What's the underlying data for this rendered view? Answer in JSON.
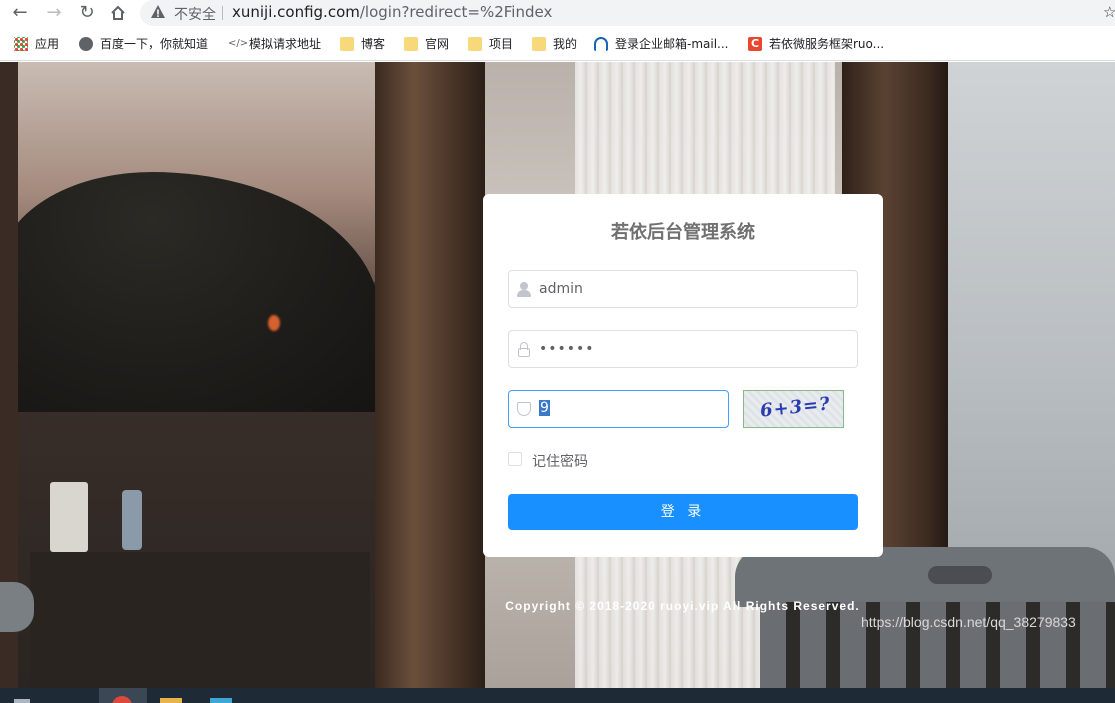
{
  "browser": {
    "security_label": "不安全",
    "url_host": "xuniji.config.com",
    "url_path": "/login?redirect=%2Findex"
  },
  "bookmarks": [
    {
      "label": "应用",
      "icon": "apps-grid-icon"
    },
    {
      "label": "百度一下，你就知道",
      "icon": "globe-icon"
    },
    {
      "label": "模拟请求地址",
      "icon": "code-icon"
    },
    {
      "label": "博客",
      "icon": "folder-icon"
    },
    {
      "label": "官网",
      "icon": "folder-icon"
    },
    {
      "label": "项目",
      "icon": "folder-icon"
    },
    {
      "label": "我的",
      "icon": "folder-icon"
    },
    {
      "label": "登录企业邮箱-mail...",
      "icon": "cloud-icon"
    },
    {
      "label": "若依微服务框架ruo...",
      "icon": "c-logo-icon"
    }
  ],
  "login": {
    "title": "若依后台管理系统",
    "username": "admin",
    "password_mask": "••••••",
    "code_value": "9",
    "captcha_text": "6+3=?",
    "remember_label": "记住密码",
    "login_button": "登 录"
  },
  "footer": {
    "copyright": "Copyright © 2018-2020 ruoyi.vip All Rights Reserved.",
    "watermark": "https://blog.csdn.net/qq_38279833"
  },
  "colors": {
    "primary": "#1890ff",
    "focus_border": "#409eff"
  }
}
